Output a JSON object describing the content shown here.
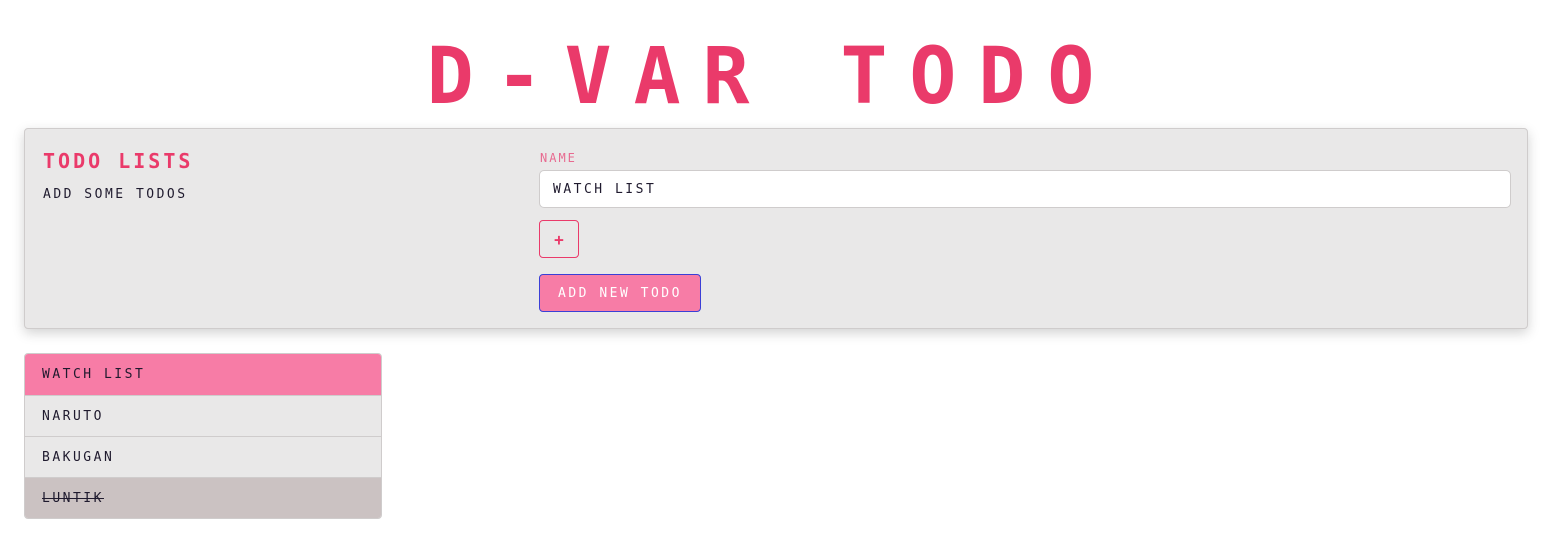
{
  "app": {
    "title": "D-VAR TODO"
  },
  "panel": {
    "title": "TODO LISTS",
    "subtitle": "ADD SOME TODOS",
    "name_label": "NAME",
    "name_value": "WATCH LIST",
    "plus_label": "+",
    "add_button_label": "ADD NEW TODO"
  },
  "list": {
    "items": [
      {
        "label": "WATCH LIST",
        "state": "active"
      },
      {
        "label": "NARUTO",
        "state": "normal"
      },
      {
        "label": "BAKUGAN",
        "state": "normal"
      },
      {
        "label": "LUNTIK",
        "state": "done"
      }
    ]
  },
  "colors": {
    "accent": "#ea3a6a",
    "accent_light": "#f77ca6",
    "panel_bg": "#e9e8e8",
    "done_bg": "#cbc2c2"
  }
}
